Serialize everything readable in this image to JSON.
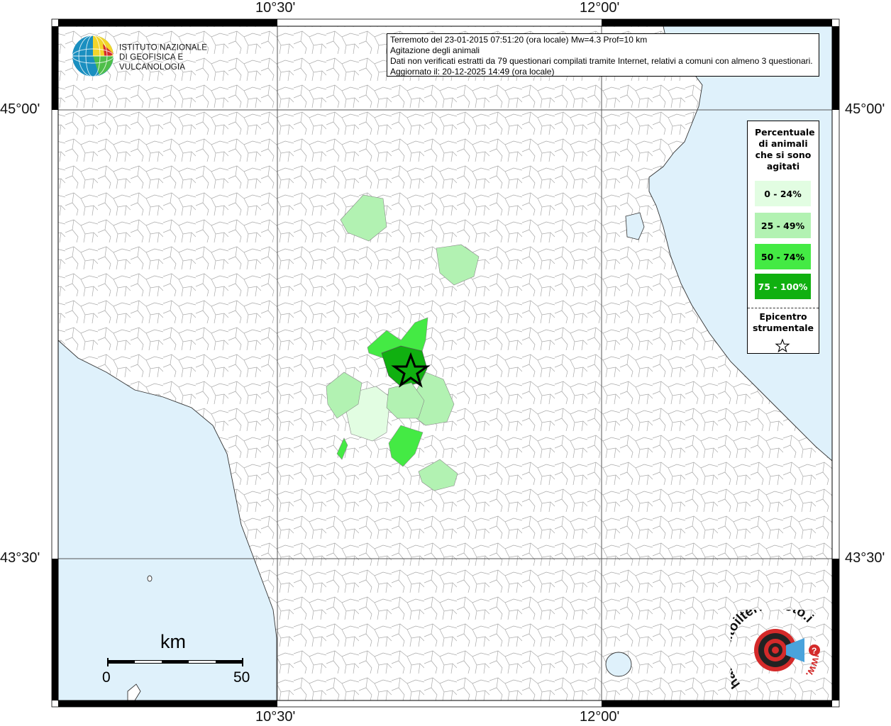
{
  "info_box": {
    "line1": "Terremoto del 23-01-2015 07:51:20 (ora locale) Mw=4.3 Prof=10 km",
    "line2": "Agitazione degli animali",
    "line3": "Dati non verificati estratti da 79 questionari compilati tramite Internet, relativi a comuni con almeno 3 questionari.",
    "line4": "Aggiornato il: 20-12-2025 14:49 (ora locale)"
  },
  "axes": {
    "top_left": "10°30'",
    "top_right": "12°00'",
    "bottom_left": "10°30'",
    "bottom_right": "12°00'",
    "left_top": "45°00'",
    "left_bottom": "43°30'",
    "right_top": "45°00'",
    "right_bottom": "43°30'"
  },
  "legend": {
    "title": "Percentuale di animali che si sono agitati",
    "classes": [
      {
        "label": "0 - 24%",
        "color": "#e2fde2",
        "text_color": "#000000"
      },
      {
        "label": "25 - 49%",
        "color": "#b2f2b2",
        "text_color": "#000000"
      },
      {
        "label": "50 - 74%",
        "color": "#44ea44",
        "text_color": "#000000"
      },
      {
        "label": "75 - 100%",
        "color": "#10b010",
        "text_color": "#ffffff"
      }
    ],
    "epicenter_title": "Epicentro strumentale",
    "epicenter_icon": "star-outline-icon"
  },
  "logo_ingv": {
    "line1": "ISTITUTO NAZIONALE",
    "line2": "DI GEOFISICA E VULCANOLOGIA"
  },
  "scale_bar": {
    "unit": "km",
    "start": "0",
    "end": "50"
  },
  "logo_hsit": {
    "text": "haisentitoilterremoto.it",
    "prefix": "www."
  },
  "colors": {
    "sea": "#dff1fb",
    "land": "#ffffff",
    "boundary": "#9a9a9a",
    "grid": "#555555",
    "frame": "#000000"
  },
  "municipalities": [
    {
      "name": "",
      "percent_class": 1
    },
    {
      "name": "",
      "percent_class": 1
    },
    {
      "name": "",
      "percent_class": 2
    },
    {
      "name": "",
      "percent_class": 3
    },
    {
      "name": "",
      "percent_class": 1
    },
    {
      "name": "",
      "percent_class": 0
    },
    {
      "name": "",
      "percent_class": 1
    },
    {
      "name": "",
      "percent_class": 1
    },
    {
      "name": "",
      "percent_class": 2
    },
    {
      "name": "",
      "percent_class": 1
    },
    {
      "name": "",
      "percent_class": 2
    }
  ]
}
